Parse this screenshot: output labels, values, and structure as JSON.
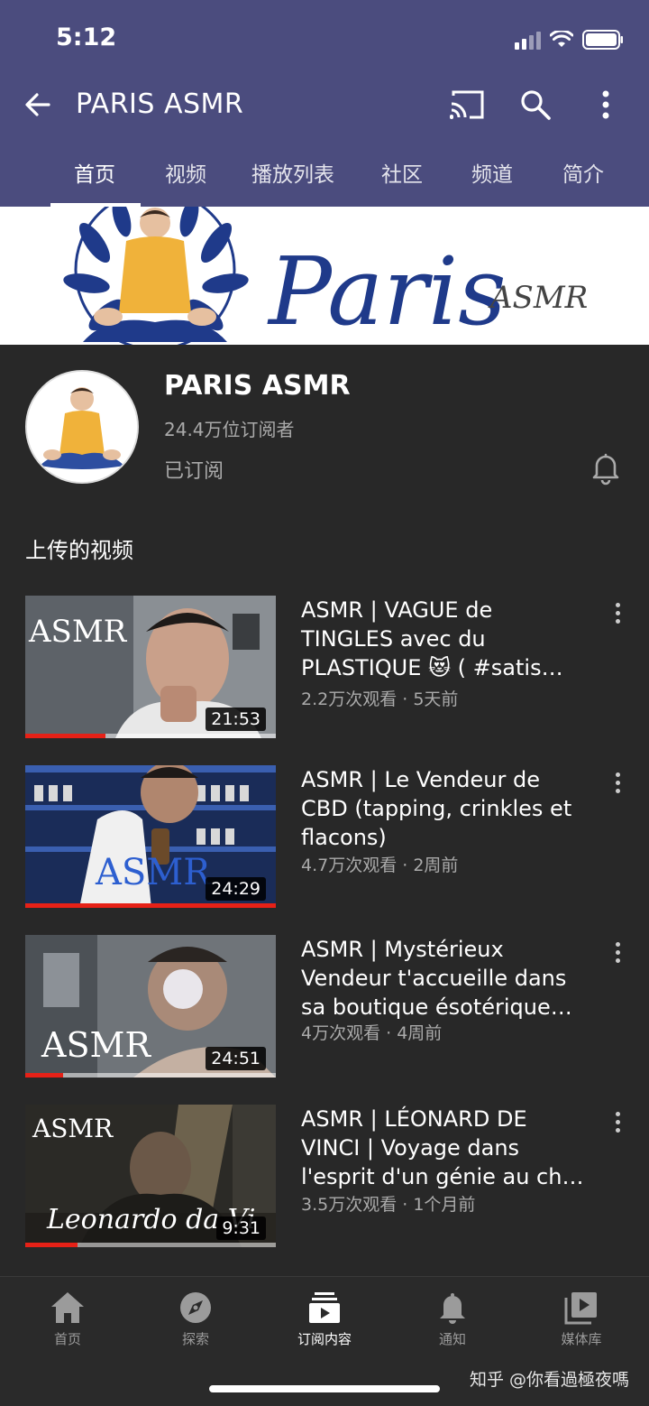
{
  "status_bar": {
    "time": "5:12"
  },
  "appbar": {
    "title": "PARIS ASMR"
  },
  "tabs": [
    {
      "label": "首页",
      "active": true
    },
    {
      "label": "视频"
    },
    {
      "label": "播放列表"
    },
    {
      "label": "社区"
    },
    {
      "label": "频道"
    },
    {
      "label": "简介"
    }
  ],
  "banner": {
    "script_text": "Paris",
    "sub_text": "ASMR"
  },
  "channel": {
    "name": "PARIS ASMR",
    "subscribers": "24.4万位订阅者",
    "subscribed_label": "已订阅"
  },
  "section": {
    "title": "上传的视频"
  },
  "videos": [
    {
      "title": "ASMR | VAGUE de TINGLES avec du PLASTIQUE 😻 ( #satis…",
      "meta": "2.2万次观看 · 5天前",
      "duration": "21:53",
      "thumb_text": "ASMR",
      "watched": 0.32
    },
    {
      "title": "ASMR | Le Vendeur de CBD (tapping, crinkles et flacons)",
      "meta": "4.7万次观看 · 2周前",
      "duration": "24:29",
      "thumb_text": "ASMR",
      "watched": 1.0
    },
    {
      "title": "ASMR | Mystérieux Vendeur t'accueille dans sa boutique ésotérique…",
      "meta": "4万次观看 · 4周前",
      "duration": "24:51",
      "thumb_text": "ASMR",
      "watched": 0.15
    },
    {
      "title": "ASMR | LÉONARD DE VINCI | Voyage dans l'esprit d'un génie au ch…",
      "meta": "3.5万次观看 · 1个月前",
      "duration": "9:31",
      "thumb_text": "ASMR",
      "thumb_script": "Leonardo da Vi",
      "watched": 0.21
    }
  ],
  "bottom_nav": [
    {
      "label": "首页",
      "icon": "home-icon"
    },
    {
      "label": "探索",
      "icon": "compass-icon"
    },
    {
      "label": "订阅内容",
      "icon": "subscriptions-icon",
      "active": true
    },
    {
      "label": "通知",
      "icon": "bell-icon"
    },
    {
      "label": "媒体库",
      "icon": "library-icon"
    }
  ],
  "watermark": "知乎 @你看過極夜嗎",
  "colors": {
    "header_bg": "#4b4c7e",
    "page_bg": "#282828",
    "progress_red": "#e62117",
    "banner_blue": "#1f3a8a"
  }
}
